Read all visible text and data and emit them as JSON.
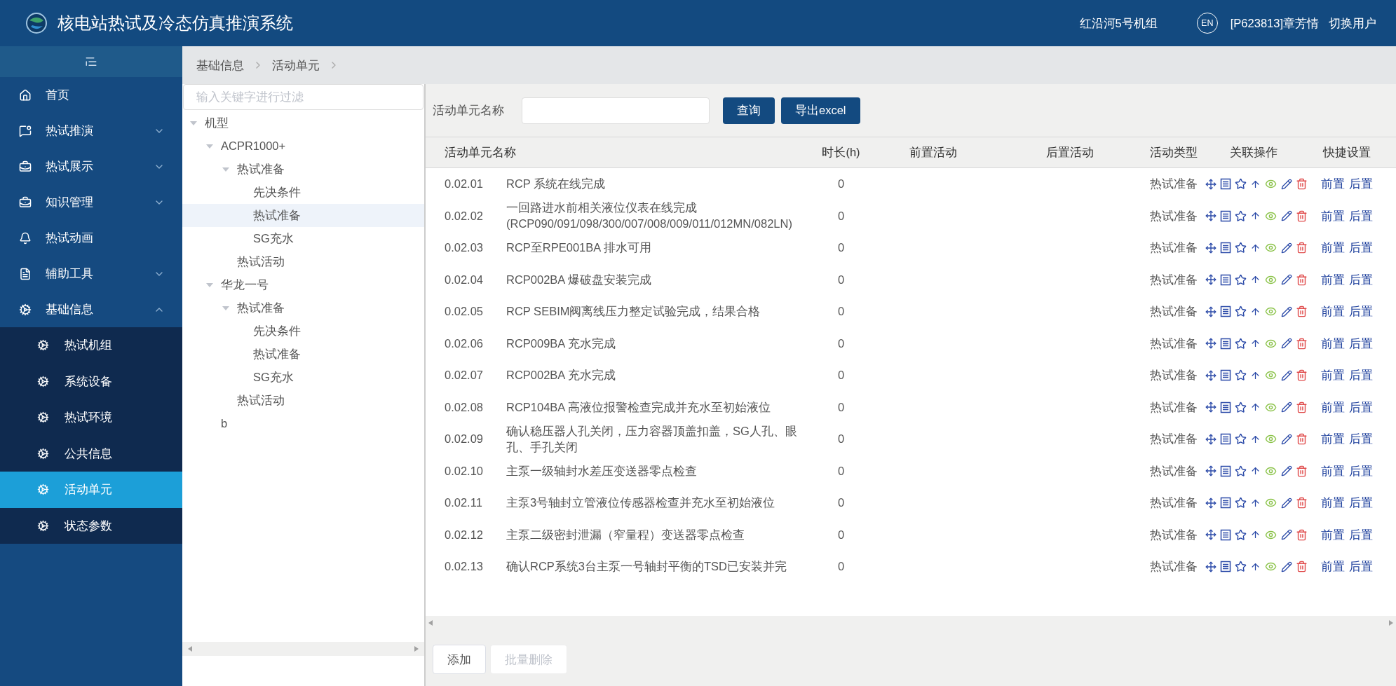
{
  "header": {
    "title": "核电站热试及冷态仿真推演系统",
    "unit": "红沿河5号机组",
    "lang": "EN",
    "user": "[P623813]章芳情",
    "switch_user": "切换用户"
  },
  "sidebar": {
    "items": [
      {
        "label": "首页",
        "selected": false
      },
      {
        "label": "热试推演",
        "expanded": false,
        "selected": false
      },
      {
        "label": "热试展示",
        "expanded": false,
        "selected": false
      },
      {
        "label": "知识管理",
        "expanded": false,
        "selected": false
      },
      {
        "label": "热试动画",
        "selected": false
      },
      {
        "label": "辅助工具",
        "expanded": false,
        "selected": false
      },
      {
        "label": "基础信息",
        "expanded": true,
        "selected": false,
        "children": [
          {
            "label": "热试机组",
            "selected": false
          },
          {
            "label": "系统设备",
            "selected": false
          },
          {
            "label": "热试环境",
            "selected": false
          },
          {
            "label": "公共信息",
            "selected": false
          },
          {
            "label": "活动单元",
            "selected": true
          },
          {
            "label": "状态参数",
            "selected": false
          }
        ]
      }
    ]
  },
  "breadcrumb": [
    "基础信息",
    "活动单元"
  ],
  "tree": {
    "placeholder": "输入关键字进行过滤",
    "nodes": [
      {
        "label": "机型",
        "expanded": true,
        "selected": false,
        "children": [
          {
            "label": "ACPR1000+",
            "expanded": true,
            "selected": false,
            "children": [
              {
                "label": "热试准备",
                "expanded": true,
                "selected": false,
                "children": [
                  {
                    "label": "先决条件",
                    "selected": false
                  },
                  {
                    "label": "热试准备",
                    "selected": true
                  },
                  {
                    "label": "SG充水",
                    "selected": false
                  }
                ]
              },
              {
                "label": "热试活动",
                "selected": false
              }
            ]
          },
          {
            "label": "华龙一号",
            "expanded": true,
            "selected": false,
            "children": [
              {
                "label": "热试准备",
                "expanded": true,
                "selected": false,
                "children": [
                  {
                    "label": "先决条件",
                    "selected": false
                  },
                  {
                    "label": "热试准备",
                    "selected": false
                  },
                  {
                    "label": "SG充水",
                    "selected": false
                  }
                ]
              },
              {
                "label": "热试活动",
                "selected": false
              }
            ]
          },
          {
            "label": "b",
            "selected": false
          }
        ]
      }
    ]
  },
  "search": {
    "label": "活动单元名称",
    "query_button": "查询",
    "export_button": "导出excel"
  },
  "table": {
    "columns": [
      "活动单元名称",
      "时长(h)",
      "前置活动",
      "后置活动",
      "活动类型",
      "关联操作",
      "快捷设置"
    ],
    "rows": [
      {
        "code": "0.02.01",
        "name": "RCP 系统在线完成",
        "duration": "0",
        "type": "热试准备",
        "links": [
          "前置",
          "后置"
        ]
      },
      {
        "code": "0.02.02",
        "name": "一回路进水前相关液位仪表在线完成(RCP090/091/098/300/007/008/009/011/012MN/082LN)",
        "duration": "0",
        "type": "热试准备",
        "links": [
          "前置",
          "后置"
        ]
      },
      {
        "code": "0.02.03",
        "name": "RCP至RPE001BA 排水可用",
        "duration": "0",
        "type": "热试准备",
        "links": [
          "前置",
          "后置"
        ]
      },
      {
        "code": "0.02.04",
        "name": "RCP002BA 爆破盘安装完成",
        "duration": "0",
        "type": "热试准备",
        "links": [
          "前置",
          "后置"
        ]
      },
      {
        "code": "0.02.05",
        "name": "RCP SEBIM阀离线压力整定试验完成，结果合格",
        "duration": "0",
        "type": "热试准备",
        "links": [
          "前置",
          "后置"
        ]
      },
      {
        "code": "0.02.06",
        "name": "RCP009BA 充水完成",
        "duration": "0",
        "type": "热试准备",
        "links": [
          "前置",
          "后置"
        ]
      },
      {
        "code": "0.02.07",
        "name": "RCP002BA 充水完成",
        "duration": "0",
        "type": "热试准备",
        "links": [
          "前置",
          "后置"
        ]
      },
      {
        "code": "0.02.08",
        "name": "RCP104BA 高液位报警检查完成并充水至初始液位",
        "duration": "0",
        "type": "热试准备",
        "links": [
          "前置",
          "后置"
        ]
      },
      {
        "code": "0.02.09",
        "name": "确认稳压器人孔关闭，压力容器顶盖扣盖，SG人孔、眼孔、手孔关闭",
        "duration": "0",
        "type": "热试准备",
        "links": [
          "前置",
          "后置"
        ]
      },
      {
        "code": "0.02.10",
        "name": "主泵一级轴封水差压变送器零点检查",
        "duration": "0",
        "type": "热试准备",
        "links": [
          "前置",
          "后置"
        ]
      },
      {
        "code": "0.02.11",
        "name": "主泵3号轴封立管液位传感器检查并充水至初始液位",
        "duration": "0",
        "type": "热试准备",
        "links": [
          "前置",
          "后置"
        ]
      },
      {
        "code": "0.02.12",
        "name": "主泵二级密封泄漏（窄量程）变送器零点检查",
        "duration": "0",
        "type": "热试准备",
        "links": [
          "前置",
          "后置"
        ]
      },
      {
        "code": "0.02.13",
        "name": "确认RCP系统3台主泵一号轴封平衡的TSD已安装并完",
        "duration": "0",
        "type": "热试准备",
        "links": [
          "前置",
          "后置"
        ]
      }
    ]
  },
  "actions": [
    {
      "label": "添加",
      "disabled": false
    },
    {
      "label": "批量删除",
      "disabled": true
    }
  ]
}
